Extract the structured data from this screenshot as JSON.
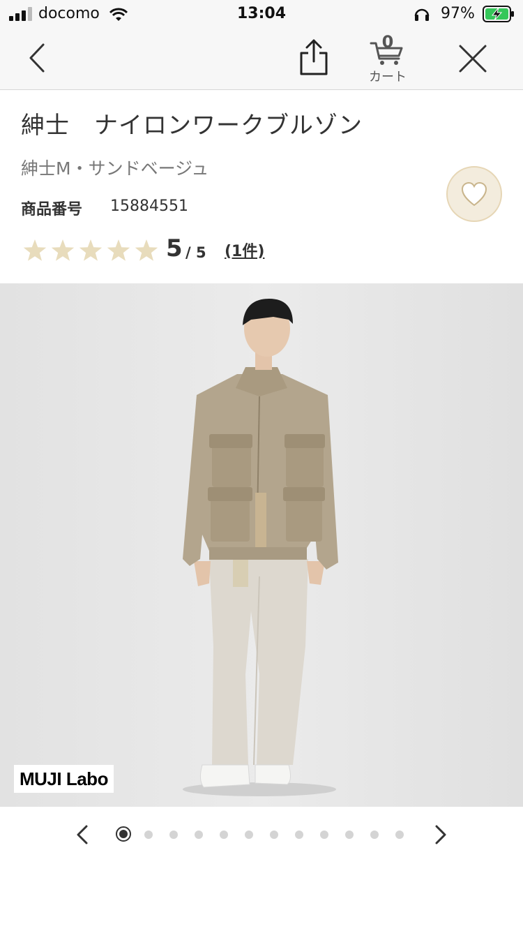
{
  "status_bar": {
    "carrier": "docomo",
    "time": "13:04",
    "battery_percent": "97%"
  },
  "nav": {
    "cart_count": "0",
    "cart_label": "カート"
  },
  "product": {
    "title": "紳士　ナイロンワークブルゾン",
    "variant": "紳士M・サンドベージュ",
    "number_label": "商品番号",
    "number": "15884551",
    "rating": {
      "stars": 5,
      "score": "5",
      "max": "/ 5",
      "count": "(1件)"
    },
    "brand_badge": "MUJI Labo"
  },
  "carousel": {
    "total": 12,
    "active_index": 0
  },
  "colors": {
    "star": "#e8dcbc",
    "fav_bg": "#f3ecdd",
    "jacket": "#b3a58d",
    "pants": "#ddd8cf"
  }
}
